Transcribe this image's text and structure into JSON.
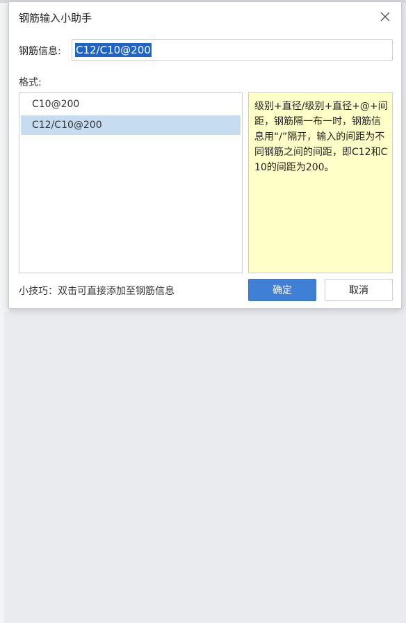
{
  "dialog": {
    "title": "钢筋输入小助手"
  },
  "info": {
    "label": "钢筋信息:",
    "value": "C12/C10@200"
  },
  "format": {
    "label": "格式:",
    "items": [
      "C10@200",
      "C12/C10@200"
    ],
    "selected_index": 1
  },
  "description": "级别+直径/级别+直径+@+间距，钢筋隔一布一时，钢筋信息用“/”隔开，输入的间距为不同钢筋之间的间距，即C12和C10的间距为200。",
  "tip": "小技巧：双击可直接添加至钢筋信息",
  "buttons": {
    "ok": "确定",
    "cancel": "取消"
  },
  "colors": {
    "accent": "#3f7fd6",
    "selection": "#c6dcf1",
    "desc_bg": "#ffffc8"
  }
}
